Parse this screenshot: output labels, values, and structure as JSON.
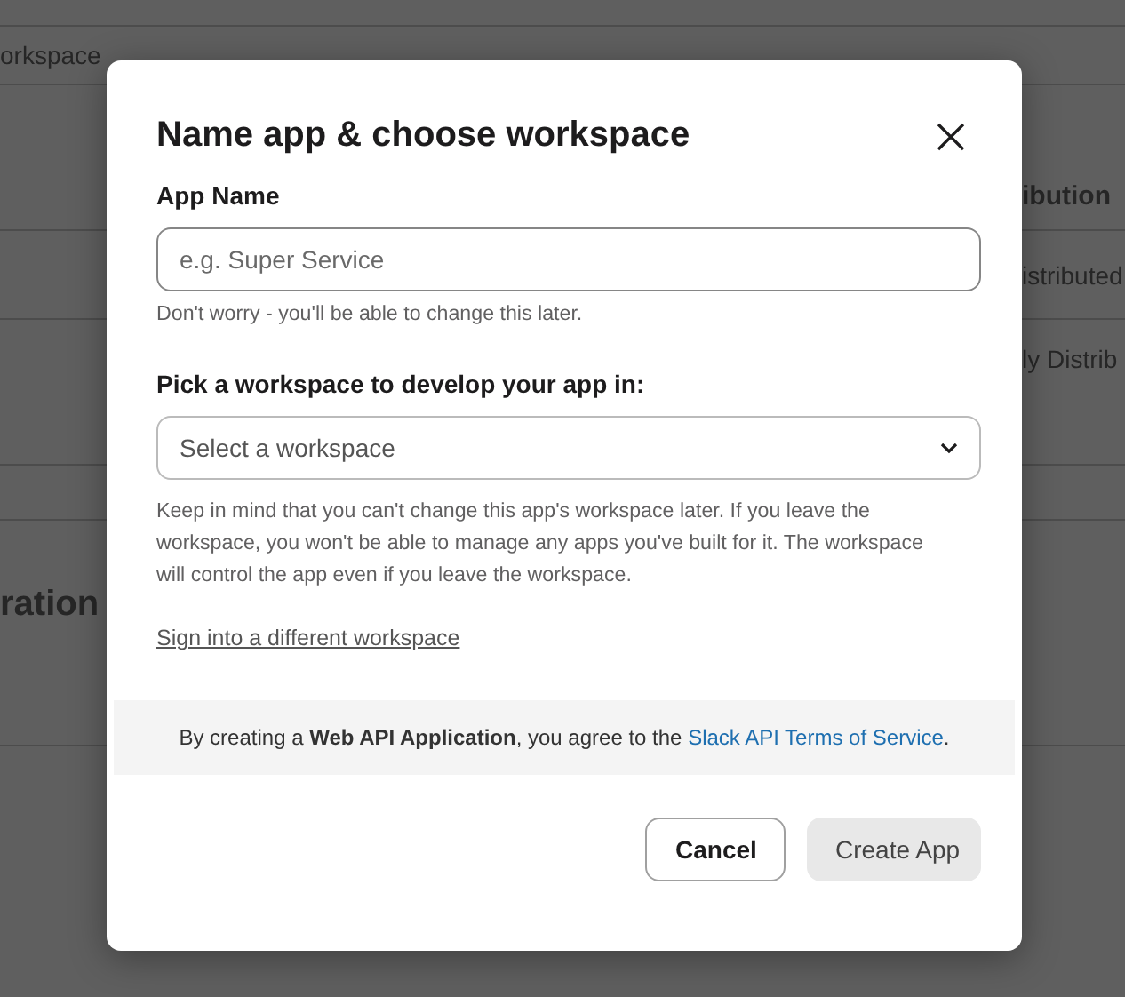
{
  "background_page": {
    "rows": [
      {
        "left": "",
        "right": ""
      },
      {
        "left": "orkspace",
        "right": ""
      },
      {
        "left": "",
        "right": "ibution"
      },
      {
        "left": "",
        "right": "istributed"
      },
      {
        "left": "",
        "right": "ly Distrib"
      },
      {
        "left": "",
        "right": ""
      },
      {
        "left": "ration",
        "right": ""
      }
    ]
  },
  "dialog": {
    "title": "Name app & choose workspace",
    "app_name": {
      "label": "App Name",
      "placeholder": "e.g. Super Service",
      "hint": "Don't worry - you'll be able to change this later."
    },
    "workspace": {
      "label": "Pick a workspace to develop your app in:",
      "placeholder": "Select a workspace",
      "hint": "Keep in mind that you can't change this app's workspace later. If you leave the workspace, you won't be able to manage any apps you've built for it. The workspace will control the app even if you leave the workspace."
    },
    "sign_in_link": "Sign into a different workspace",
    "terms": {
      "text_before": "By creating a **Web API Application**, you agree to the",
      "link": "Slack API Terms of Service",
      "text_after": "."
    },
    "buttons": [
      {
        "label": "Cancel",
        "kind": "secondary",
        "disabled": false
      },
      {
        "label": "Create App",
        "kind": "primary",
        "disabled": true
      }
    ]
  }
}
